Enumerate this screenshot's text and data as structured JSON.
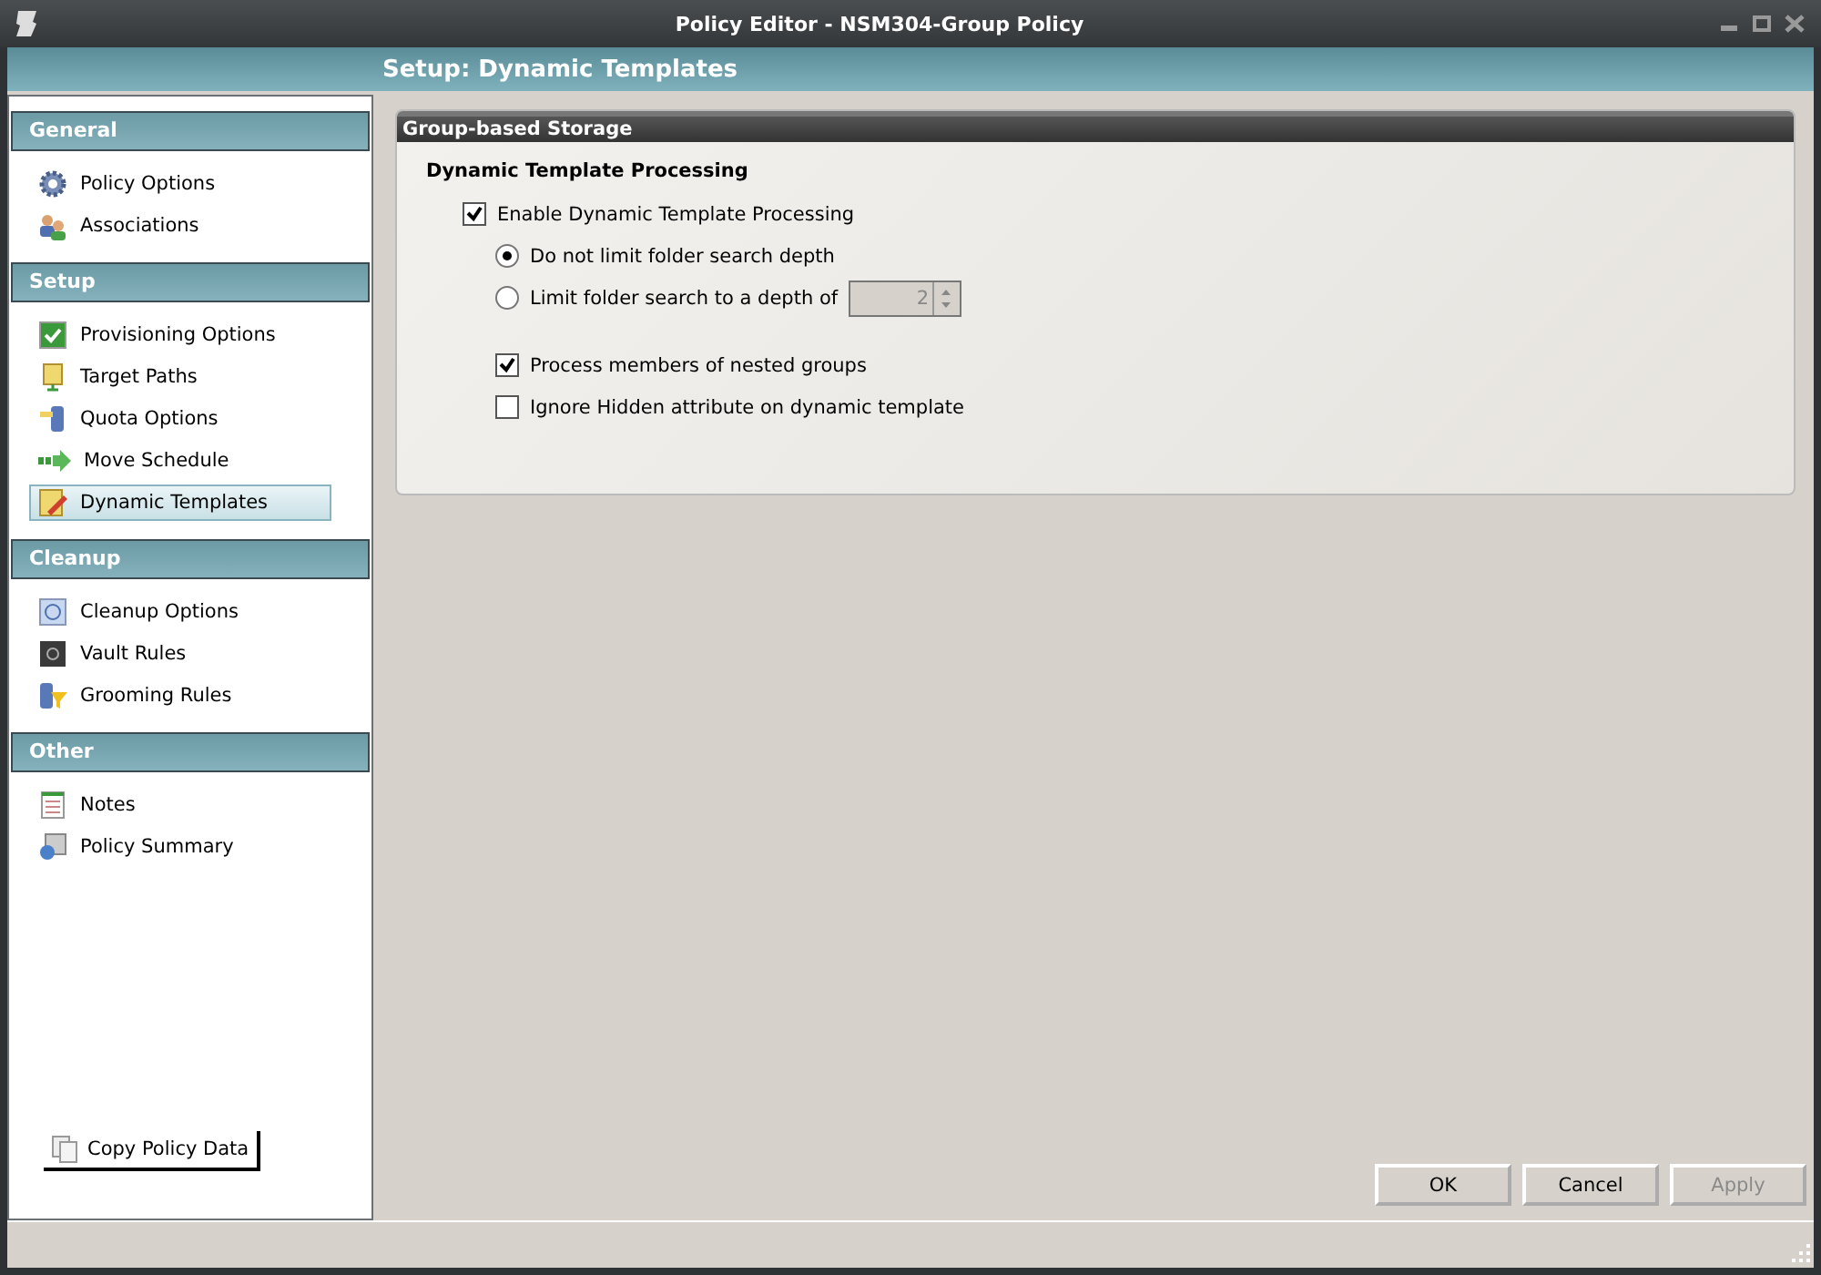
{
  "window": {
    "title": "Policy Editor - NSM304-Group Policy"
  },
  "header": {
    "title": "Setup: Dynamic Templates"
  },
  "sidebar": {
    "sections": [
      {
        "title": "General",
        "items": [
          {
            "label": "Policy Options",
            "selected": false
          },
          {
            "label": "Associations",
            "selected": false
          }
        ]
      },
      {
        "title": "Setup",
        "items": [
          {
            "label": "Provisioning Options",
            "selected": false
          },
          {
            "label": "Target Paths",
            "selected": false
          },
          {
            "label": "Quota Options",
            "selected": false
          },
          {
            "label": "Move Schedule",
            "selected": false
          },
          {
            "label": "Dynamic Templates",
            "selected": true
          }
        ]
      },
      {
        "title": "Cleanup",
        "items": [
          {
            "label": "Cleanup Options",
            "selected": false
          },
          {
            "label": "Vault Rules",
            "selected": false
          },
          {
            "label": "Grooming Rules",
            "selected": false
          }
        ]
      },
      {
        "title": "Other",
        "items": [
          {
            "label": "Notes",
            "selected": false
          },
          {
            "label": "Policy Summary",
            "selected": false
          }
        ]
      }
    ],
    "copy_button": "Copy Policy Data"
  },
  "panel": {
    "title": "Group-based Storage",
    "heading": "Dynamic Template Processing",
    "enable": {
      "label": "Enable Dynamic Template Processing",
      "checked": true
    },
    "radios": [
      {
        "label": "Do not limit folder search depth",
        "selected": true
      },
      {
        "label": "Limit folder search to a depth of",
        "selected": false
      }
    ],
    "depth": {
      "value": "2",
      "disabled": true
    },
    "options": [
      {
        "label": "Process members of nested groups",
        "checked": true
      },
      {
        "label": "Ignore Hidden attribute on dynamic template",
        "checked": false
      }
    ]
  },
  "buttons": [
    {
      "label": "OK",
      "disabled": false
    },
    {
      "label": "Cancel",
      "disabled": false
    },
    {
      "label": "Apply",
      "disabled": true
    }
  ]
}
